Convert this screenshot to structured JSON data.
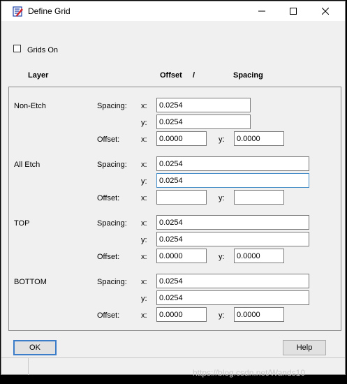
{
  "window": {
    "title": "Define Grid"
  },
  "titlebar": {
    "minimize": "—",
    "maximize": "☐",
    "close": "✕"
  },
  "grids_on": {
    "label": "Grids On",
    "checked": false
  },
  "headers": {
    "layer": "Layer",
    "offset": "Offset",
    "slash": "/",
    "spacing": "Spacing"
  },
  "layers": [
    {
      "name": "Non-Etch",
      "spacing_label": "Spacing:",
      "x_label": "x:",
      "y_label": "y:",
      "offset_label": "Offset:",
      "spacing_x": "0.0254",
      "spacing_y": "0.0254",
      "offset_x": "0.0000",
      "offset_y": "0.0000"
    },
    {
      "name": "All Etch",
      "spacing_label": "Spacing:",
      "x_label": "x:",
      "y_label": "y:",
      "offset_label": "Offset:",
      "spacing_x": "0.0254",
      "spacing_y": "0.0254",
      "offset_x": "",
      "offset_y": ""
    },
    {
      "name": "TOP",
      "spacing_label": "Spacing:",
      "x_label": "x:",
      "y_label": "y:",
      "offset_label": "Offset:",
      "spacing_x": "0.0254",
      "spacing_y": "0.0254",
      "offset_x": "0.0000",
      "offset_y": "0.0000"
    },
    {
      "name": "BOTTOM",
      "spacing_label": "Spacing:",
      "x_label": "x:",
      "y_label": "y:",
      "offset_label": "Offset:",
      "spacing_x": "0.0254",
      "spacing_y": "0.0254",
      "offset_x": "0.0000",
      "offset_y": "0.0000"
    }
  ],
  "buttons": {
    "ok": "OK",
    "help": "Help"
  },
  "watermark": "https://blog.csdn.net/Wands10"
}
